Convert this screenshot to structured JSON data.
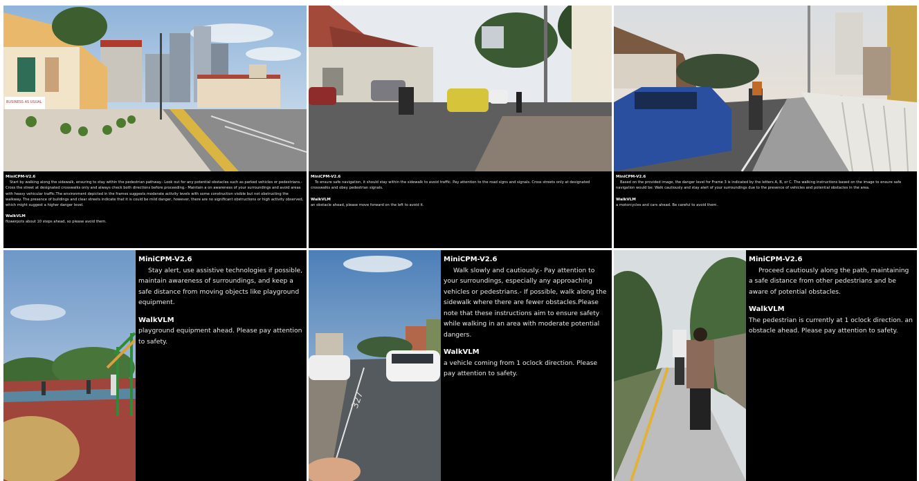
{
  "panels": [
    {
      "model_label": "MiniCPM-V2.6",
      "model_text": "Start by walking along the sidewalk, ensuring to stay within the pedestrian pathway.- Look out for any potential obstacles such as parked vehicles or pedestrians.- Cross the street at designated crosswalks only and always check both directions before proceeding.- Maintain a on awareness of your surroundings and avoid areas with heavy vehicular traffic.The environment depicted in the frames suggests moderate activity levels with some construction visible but not obstructing the walkway. The presence of buildings and clear streets indicate that it is could be mild danger, however, there are no significant obstructions or high activity observed, which might suggest a higher danger level.",
      "walk_label": "WalkVLM",
      "walk_text": "flowerpots about 10 steps ahead, so please avoid them.",
      "sign_text": "BUSINESS AS USUAL"
    },
    {
      "model_label": "MiniCPM-V2.6",
      "model_text": "To ensure safe navigation, it should stay within the sidewalk to avoid traffic. Pay attention to the road signs and signals. Cross streets only at designated crosswalks and obey pedestrian signals.",
      "walk_label": "WalkVLM",
      "walk_text": "an obstacle ahead, please move forward on the left to avoid it."
    },
    {
      "model_label": "MiniCPM-V2.6",
      "model_text": "Based on the provided image, the danger level for Frame 3 is indicated by the letters A, B, or C. The walking instructions based on the image to ensure safe navigation would be: Walk cautiously and stay alert of your surroundings due to the presence of vehicles and potential obstacles in the area.",
      "walk_label": "WalkVLM",
      "walk_text": "a motorcycles and cars ahead. Be careful to avoid them."
    },
    {
      "model_label": "MiniCPM-V2.6",
      "model_text": "Stay alert, use assistive technologies if possible, maintain awareness of surroundings, and keep a safe distance from moving objects like playground equipment.",
      "walk_label": "WalkVLM",
      "walk_text": "playground equipment ahead. Please pay attention to safety."
    },
    {
      "model_label": "MiniCPM-V2.6",
      "model_text": "Walk slowly and cautiously.- Pay attention to your surroundings, especially any approaching vehicles or pedestrians.- If possible, walk along the sidewalk where there are fewer obstacles.Please note that these instructions aim to ensure safety while walking in an area with moderate potential dangers.",
      "walk_label": "WalkVLM",
      "walk_text": "a vehicle coming from 1 oclock direction. Please pay attention to safety.",
      "road_text": "327"
    },
    {
      "model_label": "MiniCPM-V2.6",
      "model_text": "Proceed cautiously along the path, maintaining a safe distance from other pedestrians and be aware of potential obstacles.",
      "walk_label": "WalkVLM",
      "walk_text": "The pedestrian is currently at 1 oclock direction. an obstacle ahead. Please pay attention to safety."
    }
  ]
}
